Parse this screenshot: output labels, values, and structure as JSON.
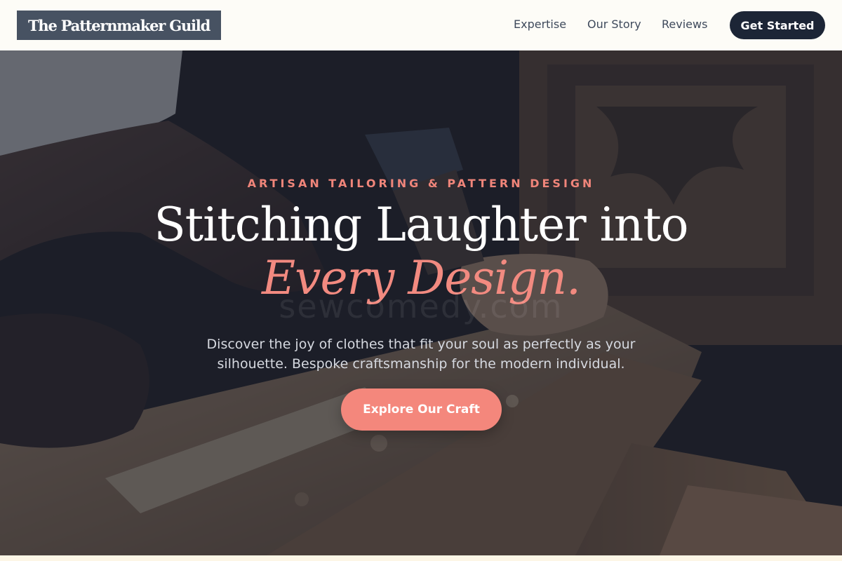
{
  "nav": {
    "logo": "The Patternmaker Guild",
    "links": [
      "Expertise",
      "Our Story",
      "Reviews"
    ],
    "cta": "Get Started"
  },
  "hero": {
    "kicker": "ARTISAN TAILORING & PATTERN DESIGN",
    "headline_line1": "Stitching Laughter into",
    "headline_line2": "Every Design.",
    "watermark": "sewcomedy.com",
    "subtitle": "Discover the joy of clothes that fit your soul as perfectly as your silhouette. Bespoke craftsmanship for the modern individual.",
    "cta": "Explore Our Craft",
    "background_image": "craftsman-carving-wood-photo"
  },
  "colors": {
    "nav_bg": "#fdfcf7",
    "logo_bg": "#475262",
    "dark_button": "#1c2536",
    "accent": "#f4877c",
    "overlay": "#141a2c"
  }
}
